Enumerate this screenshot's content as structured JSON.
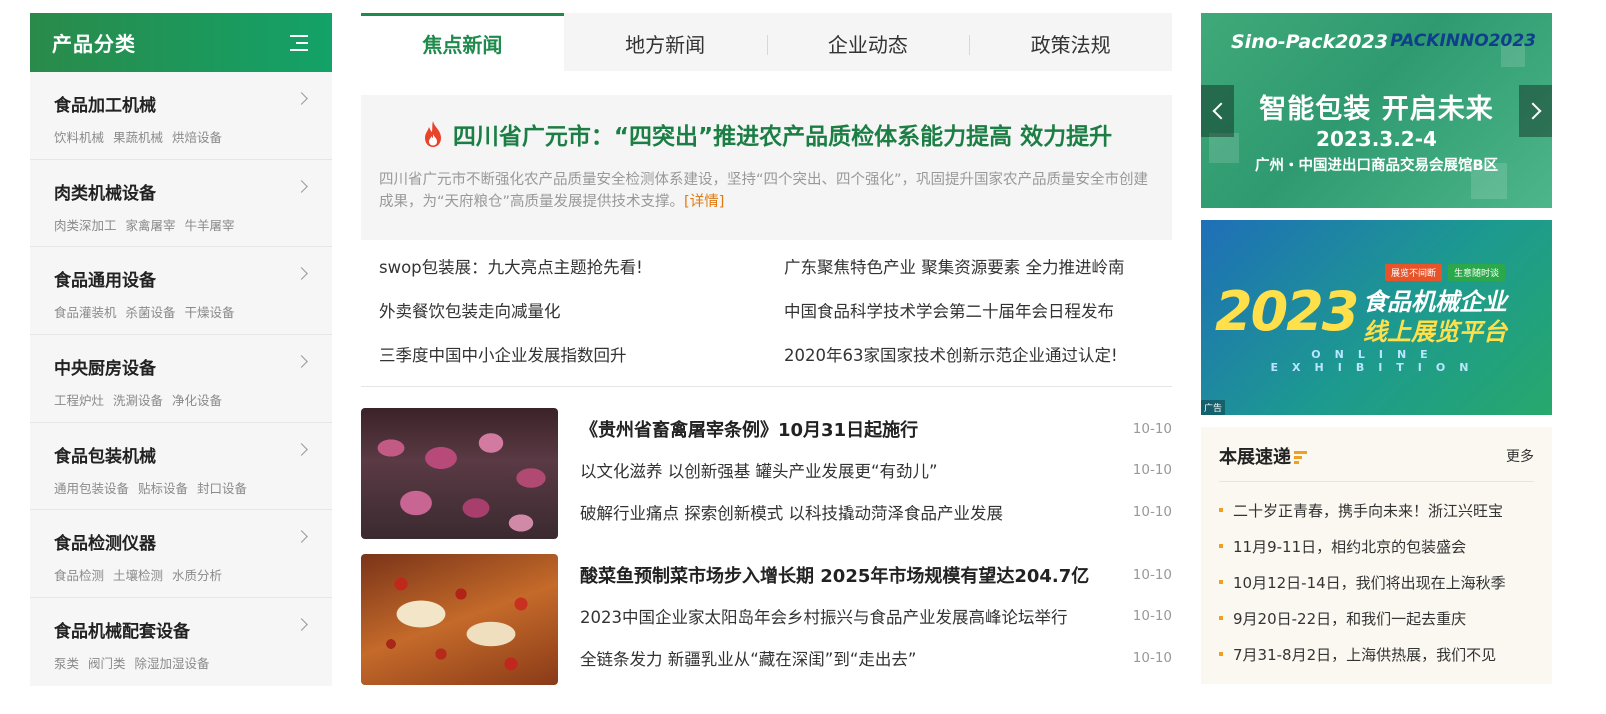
{
  "sidebar": {
    "title": "产品分类",
    "categories": [
      {
        "name": "食品加工机械",
        "subs": [
          "饮料机械",
          "果蔬机械",
          "烘焙设备"
        ]
      },
      {
        "name": "肉类机械设备",
        "subs": [
          "肉类深加工",
          "家禽屠宰",
          "牛羊屠宰"
        ]
      },
      {
        "name": "食品通用设备",
        "subs": [
          "食品灌装机",
          "杀菌设备",
          "干燥设备"
        ]
      },
      {
        "name": "中央厨房设备",
        "subs": [
          "工程炉灶",
          "洗涮设备",
          "净化设备"
        ]
      },
      {
        "name": "食品包装机械",
        "subs": [
          "通用包装设备",
          "贴标设备",
          "封口设备"
        ]
      },
      {
        "name": "食品检测仪器",
        "subs": [
          "食品检测",
          "土壤检测",
          "水质分析"
        ]
      },
      {
        "name": "食品机械配套设备",
        "subs": [
          "泵类",
          "阀门类",
          "除湿加湿设备"
        ]
      }
    ]
  },
  "tabs": [
    "焦点新闻",
    "地方新闻",
    "企业动态",
    "政策法规"
  ],
  "headline": {
    "title": "四川省广元市：“四突出”推进农产品质检体系能力提高 效力提升",
    "summary": "四川省广元市不断强化农产品质量安全检测体系建设，坚持“四个突出、四个强化”，巩固提升国家农产品质量安全市创建成果，为“天府粮仓”高质量发展提供技术支撑。",
    "more": "[详情]"
  },
  "news_left": [
    "swop包装展：九大亮点主题抢先看!",
    "外卖餐饮包装走向减量化",
    "三季度中国中小企业发展指数回升"
  ],
  "news_right": [
    "广东聚焦特色产业 聚集资源要素 全力推进岭南",
    "中国食品科学技术学会第二十届年会日程发布",
    "2020年63家国家技术创新示范企业通过认定!"
  ],
  "photo_news": [
    {
      "items": [
        {
          "title": "《贵州省畜禽屠宰条例》10月31日起施行",
          "date": "10-10"
        },
        {
          "title": "以文化滋养 以创新强基 罐头产业发展更“有劲儿”",
          "date": "10-10"
        },
        {
          "title": "破解行业痛点 探索创新模式 以科技撬动菏泽食品产业发展",
          "date": "10-10"
        }
      ]
    },
    {
      "items": [
        {
          "title": "酸菜鱼预制菜市场步入增长期 2025年市场规模有望达204.7亿",
          "date": "10-10"
        },
        {
          "title": "2023中国企业家太阳岛年会乡村振兴与食品产业发展高峰论坛举行",
          "date": "10-10"
        },
        {
          "title": "全链条发力 新疆乳业从“藏在深闺”到“走出去”",
          "date": "10-10"
        }
      ]
    }
  ],
  "banner1": {
    "brand_left": "Sino-Pack2023",
    "brand_right": "PACKINNO2023",
    "headline": "智能包装 开启未来",
    "date": "2023.3.2-4",
    "place": "广州・中国进出口商品交易会展馆B区"
  },
  "banner2": {
    "tags": [
      "展览不间断",
      "生意随时谈"
    ],
    "year": "2023",
    "line1": "食品机械企业",
    "line2": "线上展览平台",
    "en": "ONLINE EXHIBITION",
    "ad": "广告"
  },
  "quick": {
    "title": "本展速递",
    "more": "更多",
    "items": [
      "二十岁正青春，携手向未来！浙江兴旺宝",
      "11月9-11日，相约北京的包装盛会",
      "10月12日-14日，我们将出现在上海秋季",
      "9月20日-22日，和我们一起去重庆",
      "7月31-8月2日，上海供热展，我们不见"
    ]
  },
  "colors": {
    "brand_green": "#1f8a4c",
    "accent_orange": "#f0a020"
  }
}
